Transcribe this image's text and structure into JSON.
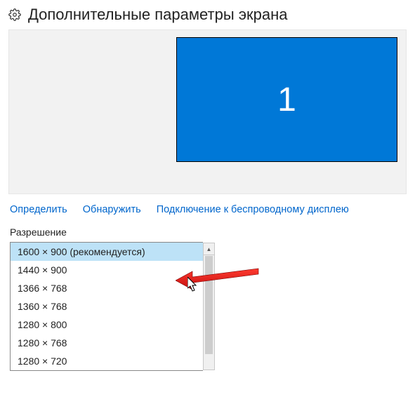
{
  "header": {
    "title": "Дополнительные параметры экрана"
  },
  "monitor": {
    "number": "1"
  },
  "links": {
    "identify": "Определить",
    "detect": "Обнаружить",
    "wireless": "Подключение к беспроводному дисплею"
  },
  "resolution": {
    "label": "Разрешение",
    "options": [
      "1600 × 900 (рекомендуется)",
      "1440 × 900",
      "1366 × 768",
      "1360 × 768",
      "1280 × 800",
      "1280 × 768",
      "1280 × 720"
    ],
    "selected_index": 0
  }
}
